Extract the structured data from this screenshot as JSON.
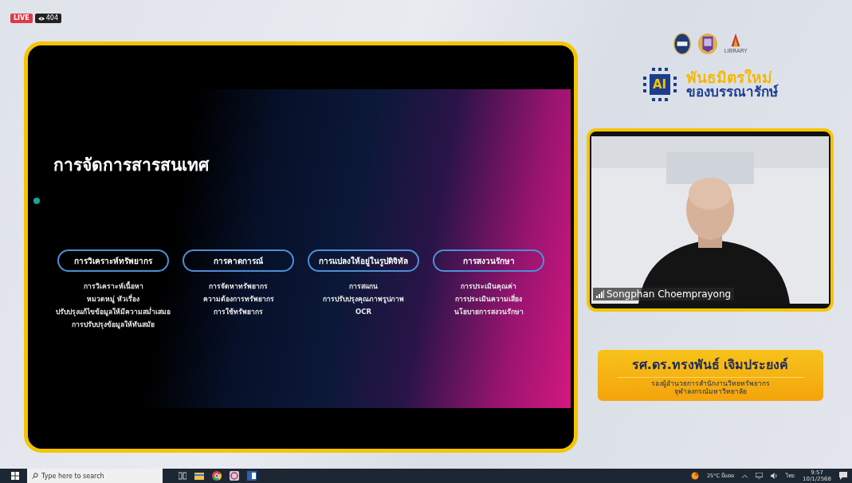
{
  "stream": {
    "live_badge": "LIVE",
    "viewer_count": "404"
  },
  "slide": {
    "title": "การจัดการสารสนเทศ",
    "columns": [
      {
        "heading": "การวิเคราะห์ทรัพยากร",
        "items": [
          "การวิเคราะห์เนื้อหา",
          "หมวดหมู่ หัวเรื่อง",
          "ปรับปรุงแก้ไขข้อมูลให้มีความสม่ำเสมอ",
          "การปรับปรุงข้อมูลให้ทันสมัย"
        ]
      },
      {
        "heading": "การคาดการณ์",
        "items": [
          "การจัดหาทรัพยากร",
          "ความต้องการทรัพยากร",
          "การใช้ทรัพยากร"
        ]
      },
      {
        "heading": "การแปลงให้อยู่ในรูปดิจิทัล",
        "items": [
          "การสแกน",
          "การปรับปรุงคุณภาพรูปภาพ",
          "OCR"
        ]
      },
      {
        "heading": "การสงวนรักษา",
        "items": [
          "การประเมินคุณค่า",
          "การประเมินความเสี่ยง",
          "นโยบายการสงวนรักษา"
        ]
      }
    ]
  },
  "sidebar": {
    "library_caption": "LIBRARY",
    "event_title": {
      "badge": "AI",
      "line_1": "พันธมิตรใหม่",
      "line_2": "ของบรรณารักษ์"
    },
    "camera": {
      "participant_name": "Songphan Choemprayong"
    },
    "speaker": {
      "name": "รศ.ดร.ทรงพันธ์ เจิมประยงค์",
      "position_lines": [
        "รองผู้อำนวยการสำนักงานวิทยทรัพยากร",
        "จุฬาลงกรณ์มหาวิทยาลัย"
      ]
    }
  },
  "taskbar": {
    "search_placeholder": "Type here to search",
    "weather": "25°C มีแดด",
    "language": "ไทย",
    "time": "9:57",
    "date": "10/1/2568"
  }
}
